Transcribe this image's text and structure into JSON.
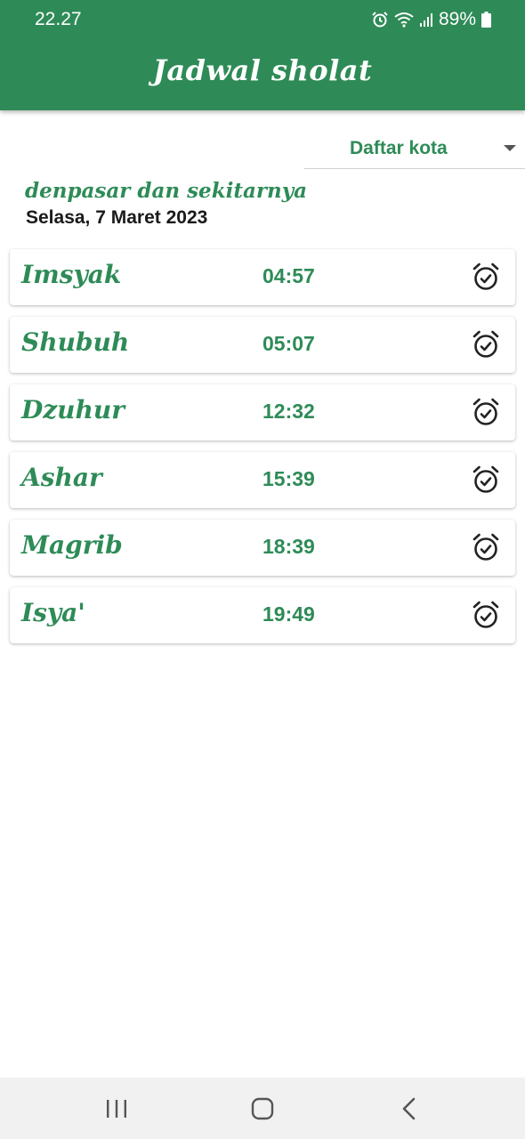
{
  "status_bar": {
    "time": "22.27",
    "battery": "89%",
    "icons": [
      "alarm-icon",
      "wifi-icon",
      "signal-icon",
      "battery-icon"
    ]
  },
  "app_bar": {
    "title": "Jadwal sholat"
  },
  "city_dropdown": {
    "label": "Daftar kota"
  },
  "location": "denpasar dan sekitarnya",
  "date": "Selasa, 7 Maret 2023",
  "prayers": [
    {
      "name": "Imsyak",
      "time": "04:57",
      "icon": "alarm-check-icon"
    },
    {
      "name": "Shubuh",
      "time": "05:07",
      "icon": "alarm-check-icon"
    },
    {
      "name": "Dzuhur",
      "time": "12:32",
      "icon": "alarm-check-icon"
    },
    {
      "name": "Ashar",
      "time": "15:39",
      "icon": "alarm-check-icon"
    },
    {
      "name": "Magrib",
      "time": "18:39",
      "icon": "alarm-check-icon"
    },
    {
      "name": "Isya'",
      "time": "19:49",
      "icon": "alarm-check-icon"
    }
  ],
  "colors": {
    "primary": "#2e8b57",
    "nav_bar": "#f1f1f1",
    "text_dark": "#1a1a1a"
  },
  "nav_bar": {
    "buttons": [
      "recents-icon",
      "home-icon",
      "back-icon"
    ]
  }
}
